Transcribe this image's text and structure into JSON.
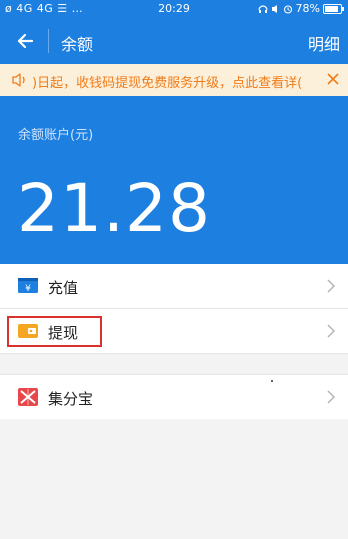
{
  "status_bar": {
    "left_text": "ø 4G 4G ☰ …",
    "time": "20:29",
    "battery": "78%",
    "battery_level": 0.78
  },
  "header": {
    "title": "余额",
    "detail_label": "明细"
  },
  "notice": {
    "text": ")日起，收钱码提现免费服务升级，点此查看详(",
    "bg_color": "#fdf0da",
    "text_color": "#f07c19"
  },
  "balance": {
    "label": "余额账户(元)",
    "amount": "21.28"
  },
  "menu": {
    "topup_label": "充值",
    "withdraw_label": "提现",
    "jifenbao_label": "集分宝"
  },
  "colors": {
    "brand_blue": "#1d7fe0",
    "highlight_red": "#d8322f"
  },
  "icons": {
    "back": "back-arrow-icon",
    "speaker": "speaker-icon",
    "close": "close-icon",
    "topup": "topup-card-icon",
    "withdraw": "wallet-icon",
    "jifenbao": "jifenbao-icon",
    "chevron": "chevron-right-icon"
  }
}
